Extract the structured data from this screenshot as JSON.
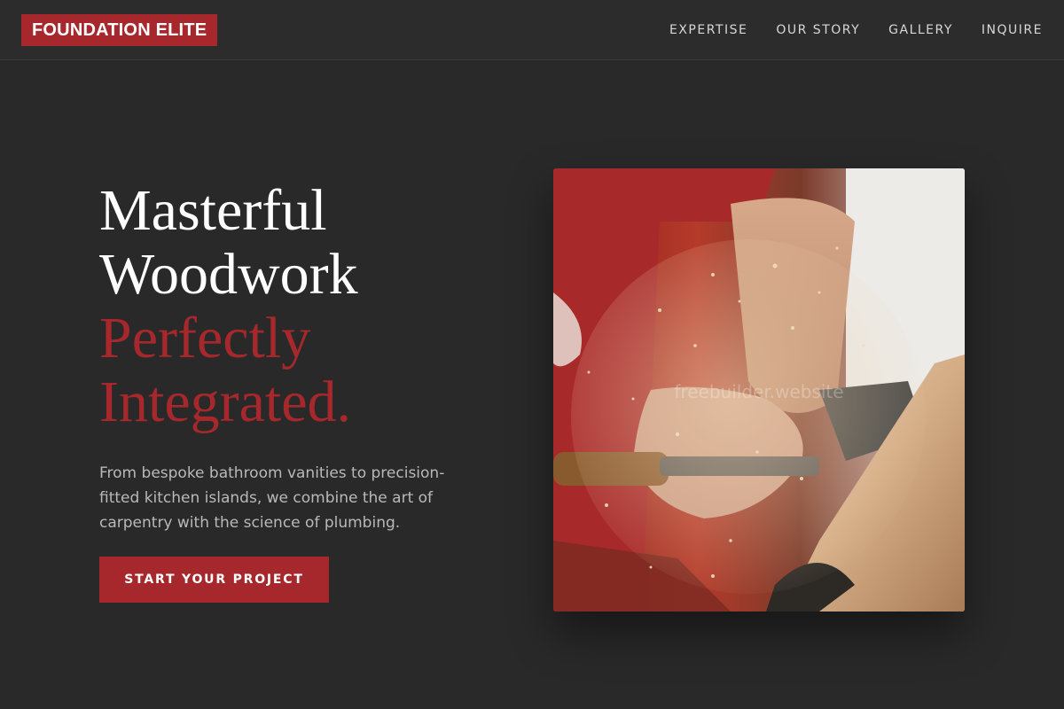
{
  "brand": {
    "logo_text": "FOUNDATION ELITE",
    "accent_color": "#a6282c",
    "background_color": "#292929"
  },
  "nav": {
    "items": [
      {
        "label": "EXPERTISE"
      },
      {
        "label": "OUR STORY"
      },
      {
        "label": "GALLERY"
      },
      {
        "label": "INQUIRE"
      }
    ]
  },
  "hero": {
    "headline_line1": "Masterful",
    "headline_line2": "Woodwork",
    "headline_line3": "Perfectly",
    "headline_line4": "Integrated.",
    "description": "From bespoke bathroom vanities to precision-fitted kitchen islands, we combine the art of carpentry with the science of plumbing.",
    "cta_label": "START YOUR PROJECT",
    "image_watermark": "freebuilder.website"
  }
}
